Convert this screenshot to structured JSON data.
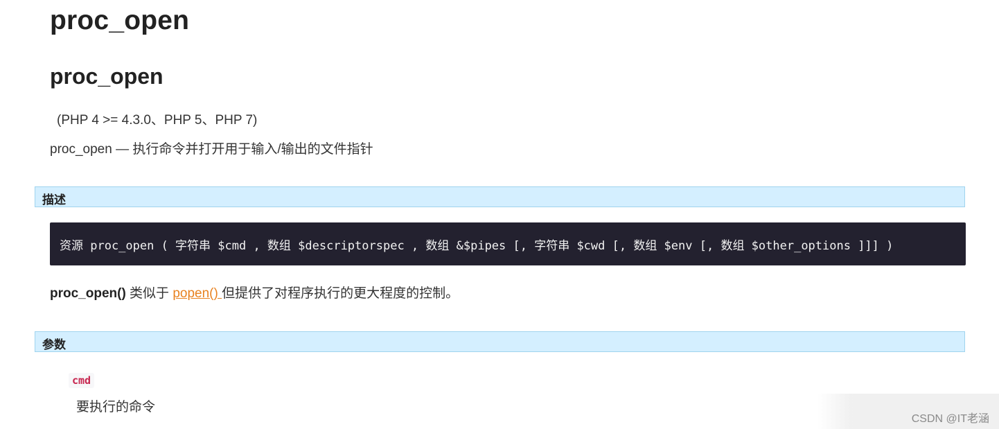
{
  "page": {
    "title": "proc_open",
    "subtitle": "proc_open",
    "version": "(PHP 4 >= 4.3.0、PHP 5、PHP 7)",
    "refpurpose": "proc_open — 执行命令并打开用于输入/输出的文件指针"
  },
  "description": {
    "heading": "描述",
    "synopsis": "资源 proc_open ( 字符串 $cmd , 数组 $descriptorspec , 数组 &$pipes [, 字符串 $cwd [, 数组 $env [, 数组 $other_options ]]] )",
    "para_func": "proc_open()",
    "para_text1": " 类似于 ",
    "para_link": "popen() ",
    "para_text2": "但提供了对程序执行的更大程度的控制。"
  },
  "parameters": {
    "heading": "参数",
    "items": [
      {
        "name": "cmd",
        "description": "要执行的命令"
      }
    ]
  },
  "watermark": "CSDN @IT老涵",
  "colors": {
    "section_bg": "#d4efff",
    "section_border": "#9fd3ee",
    "code_bg": "#23212f",
    "link": "#e8811f",
    "param_name": "#c7254e"
  }
}
